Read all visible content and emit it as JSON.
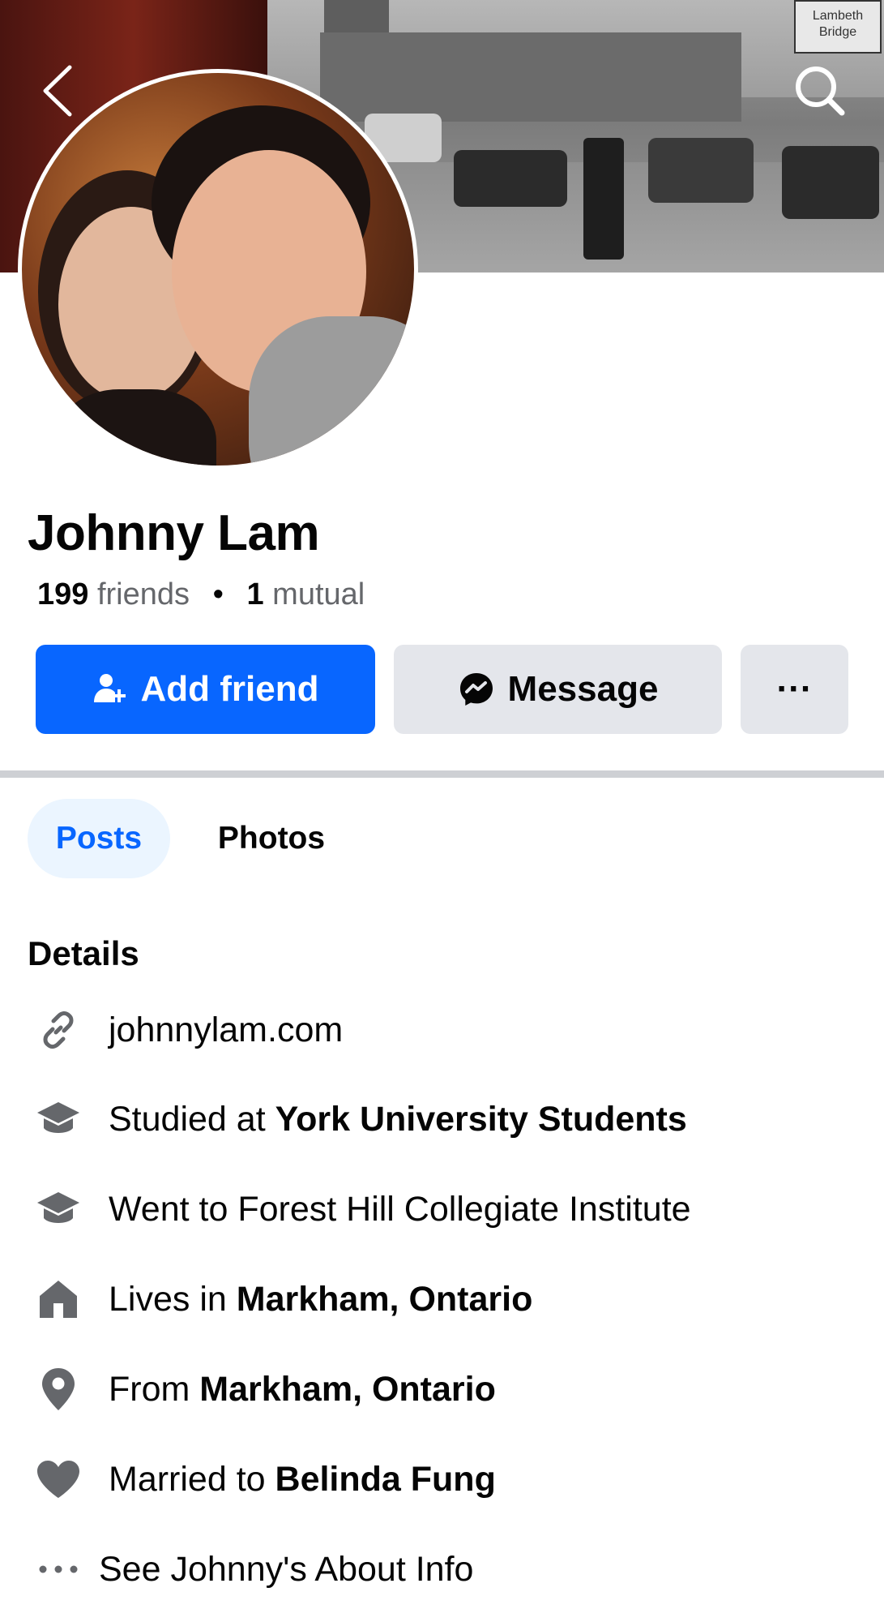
{
  "profile": {
    "name": "Johnny Lam",
    "friends_count": "199",
    "friends_label": "friends",
    "mutual_count": "1",
    "mutual_label": "mutual"
  },
  "cover": {
    "sign_text_1": "Lambeth",
    "sign_text_2": "Bridge"
  },
  "actions": {
    "add_friend_label": "Add friend",
    "message_label": "Message",
    "more_label": "···"
  },
  "tabs": [
    {
      "label": "Posts",
      "active": true
    },
    {
      "label": "Photos",
      "active": false
    }
  ],
  "details": {
    "title": "Details",
    "website": "johnnylam.com",
    "studied_prefix": "Studied at ",
    "studied_value": "York University Students",
    "went_to": "Went to Forest Hill Collegiate Institute",
    "lives_prefix": "Lives in ",
    "lives_value": "Markham, Ontario",
    "from_prefix": "From ",
    "from_value": "Markham, Ontario",
    "married_prefix": "Married to ",
    "married_value": "Belinda Fung",
    "see_about": "See Johnny's About Info"
  },
  "colors": {
    "accent": "#0866ff",
    "button_gray": "#e4e6eb",
    "tab_active_bg": "#ebf5ff",
    "icon_gray": "#65676b"
  },
  "icons": [
    "back-arrow-icon",
    "search-icon",
    "add-person-icon",
    "messenger-icon",
    "link-icon",
    "graduation-cap-icon",
    "house-icon",
    "location-pin-icon",
    "heart-icon",
    "more-dots-icon"
  ]
}
